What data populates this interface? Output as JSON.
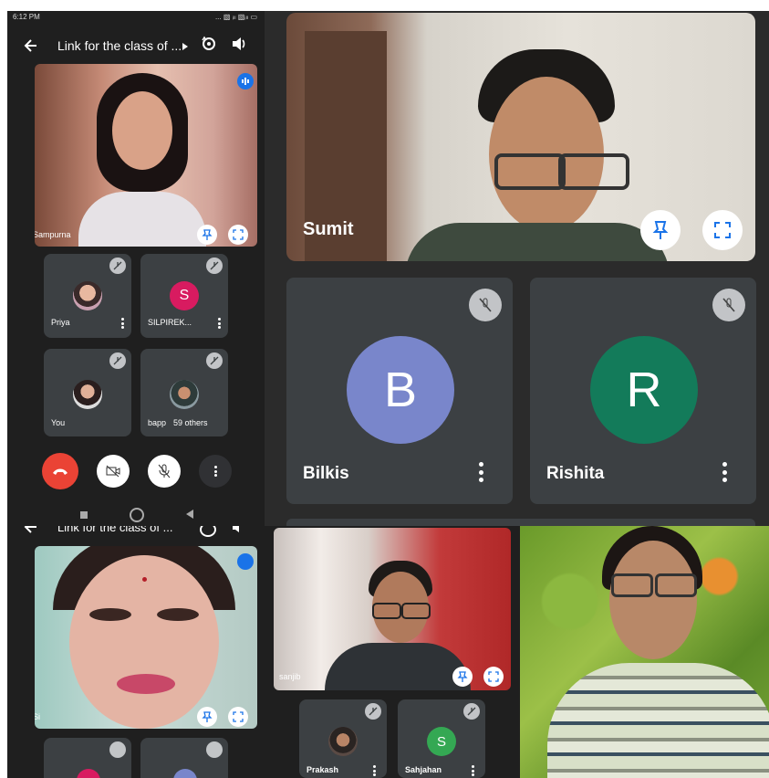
{
  "phone_top": {
    "status_time": "6:12 PM",
    "status_icons": "... ▧ ᵢₗₗ ▧ᵢₗₗ ▭",
    "title": "Link for the class of ...",
    "main_speaker": "Sampurna",
    "participants": [
      {
        "name": "Priya",
        "type": "photo"
      },
      {
        "name": "SILPIREK...",
        "initial": "S",
        "color": "#d81b60"
      },
      {
        "name": "You",
        "type": "photo"
      },
      {
        "name": "bapp",
        "extra": "59 others",
        "type": "photo"
      }
    ],
    "controls": [
      "end-call",
      "camera-off",
      "mic-off",
      "more"
    ]
  },
  "desktop": {
    "main_speaker": "Sumit",
    "tiles": [
      {
        "name": "Bilkis",
        "initial": "B",
        "color": "#7986cb"
      },
      {
        "name": "Rishita",
        "initial": "R",
        "color": "#137b5a"
      }
    ]
  },
  "phone_bottom_left": {
    "title": "Link for the class of ...",
    "main_speaker_partial": "Si"
  },
  "phone_bottom_mid": {
    "main_speaker": "sanjib",
    "participants": [
      {
        "name": "Prakash",
        "type": "photo"
      },
      {
        "name": "Sahjahan",
        "initial": "S",
        "color": "#34a853"
      }
    ]
  },
  "colors": {
    "meet_bg": "#202124",
    "tile_bg": "#3c4043",
    "end_call": "#ea4335",
    "accent_blue": "#1a73e8"
  }
}
